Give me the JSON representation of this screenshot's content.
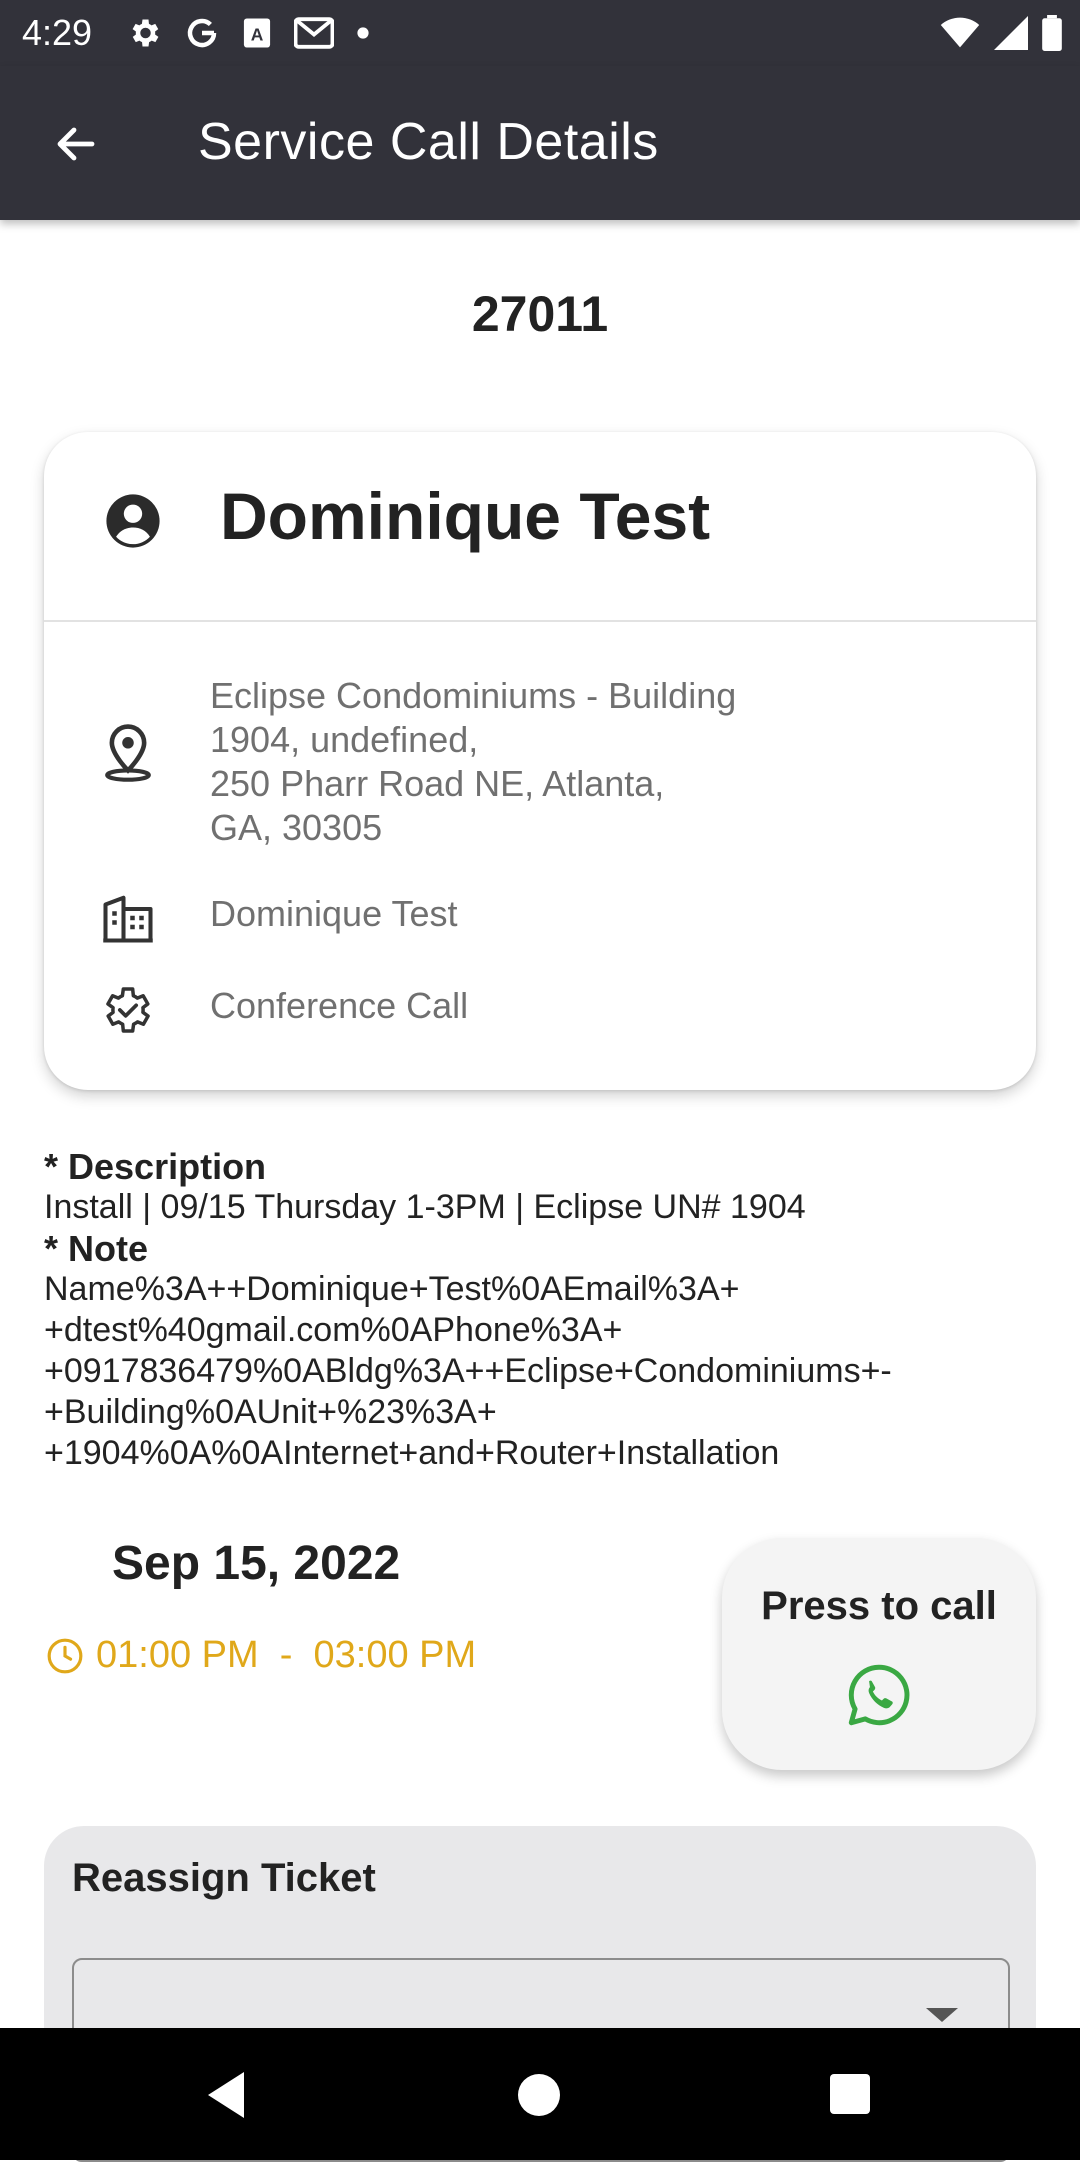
{
  "status_bar": {
    "time": "4:29",
    "left_icons": [
      "gear-icon",
      "google-icon",
      "a-icon",
      "gmail-icon",
      "dot-icon"
    ],
    "right_icons": [
      "wifi-icon",
      "signal-icon",
      "battery-icon"
    ]
  },
  "app_bar": {
    "title": "Service Call Details",
    "back_icon": "arrow-left-icon"
  },
  "ticket": {
    "number": "27011"
  },
  "card": {
    "customer_name": "Dominique Test",
    "address": "Eclipse Condominiums - Building\n 1904, undefined,\n250   Pharr Road NE, Atlanta,\nGA, 30305",
    "company": "Dominique Test",
    "service_type": "Conference Call"
  },
  "description": {
    "label": "* Description",
    "text": "Install | 09/15 Thursday 1-3PM | Eclipse UN# 1904",
    "note_label": "* Note",
    "note_text": "Name%3A++Dominique+Test%0AEmail%3A+\n+dtest%40gmail.com%0APhone%3A+\n+0917836479%0ABldg%3A++Eclipse+Condominiums+-\n+Building%0AUnit+%23%3A+\n+1904%0A%0AInternet+and+Router+Installation"
  },
  "schedule": {
    "date": "Sep 15, 2022",
    "time_range": "01:00 PM  -  03:00 PM",
    "accent_color": "#e0a81a"
  },
  "call_button": {
    "label": "Press to call",
    "icon": "whatsapp-icon",
    "icon_color": "#3aa843"
  },
  "reassign": {
    "title": "Reassign Ticket",
    "selected_value": ""
  },
  "nav_bar": {
    "icons": [
      "nav-back-icon",
      "nav-home-icon",
      "nav-recents-icon"
    ]
  }
}
